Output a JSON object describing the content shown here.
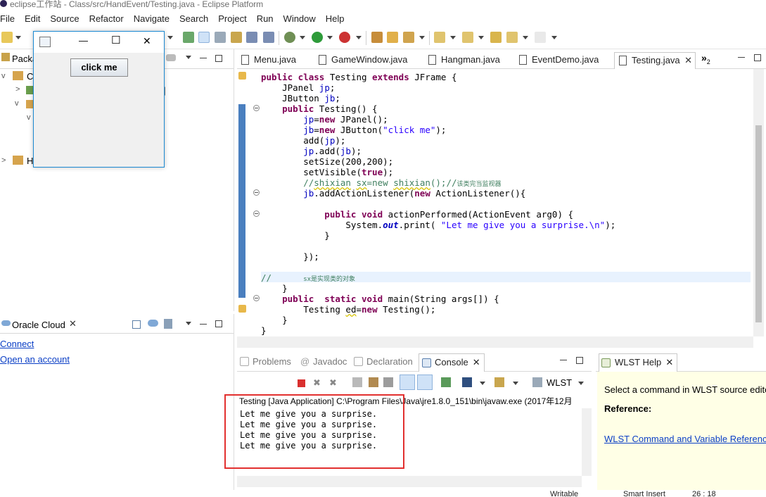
{
  "window": {
    "title": "eclipse工作站 - Class/src/HandEvent/Testing.java - Eclipse Platform"
  },
  "menu": [
    "File",
    "Edit",
    "Source",
    "Refactor",
    "Navigate",
    "Search",
    "Project",
    "Run",
    "Window",
    "Help"
  ],
  "package_explorer": {
    "tab_label": "Packa",
    "rows": [
      {
        "label": "Cl"
      },
      {
        "label": "H"
      }
    ],
    "bracket": "]"
  },
  "editor": {
    "tabs": [
      {
        "label": "Menu.java"
      },
      {
        "label": "GameWindow.java"
      },
      {
        "label": "Hangman.java"
      },
      {
        "label": "EventDemo.java"
      },
      {
        "label": "Testing.java"
      }
    ],
    "overflow_label": "»",
    "overflow_count": "2",
    "code": {
      "l1_kw1": "public class",
      "l1_name": " Testing ",
      "l1_kw2": "extends",
      "l1_rest": " JFrame {",
      "l2_type": "    JPanel ",
      "l2_fld": "jp",
      "l2_end": ";",
      "l3_type": "    JButton ",
      "l3_fld": "jb",
      "l3_end": ";",
      "l4_kw": "    public",
      "l4_rest": " Testing() {",
      "l5_fld": "        jp",
      "l5_eq": "=",
      "l5_kw": "new",
      "l5_rest": " JPanel();",
      "l6_fld": "        jb",
      "l6_eq": "=",
      "l6_kw": "new",
      "l6_mid": " JButton(",
      "l6_str": "\"click me\"",
      "l6_end": ");",
      "l7_a": "        add(",
      "l7_fld": "jp",
      "l7_b": ");",
      "l8_fld": "        jp",
      "l8_a": ".add(",
      "l8_fld2": "jb",
      "l8_b": ");",
      "l9": "        setSize(200,200);",
      "l10_a": "        setVisible(",
      "l10_kw": "true",
      "l10_b": ");",
      "l11_a": "        //",
      "l11_u1": "shixian",
      "l11_b": " ",
      "l11_u2": "sx",
      "l11_c": "=new ",
      "l11_u3": "shixian",
      "l11_d": "();//",
      "l11_z": "该类完当监视器",
      "l12_fld": "        jb",
      "l12_a": ".addActionListener(",
      "l12_kw": "new",
      "l12_b": " ActionListener(){",
      "l14_kw": "            public void",
      "l14_rest": " actionPerformed(ActionEvent arg0) {",
      "l15_a": "                System.",
      "l15_it": "out",
      "l15_b": ".print( ",
      "l15_str": "\"Let me give you a surprise.\\n\"",
      "l15_c": ");",
      "l16": "            }",
      "l18": "        });",
      "l20_a": "//      ",
      "l20_z": "sx是实现类的对象",
      "l21": "    }",
      "l22_kw": "    public  static void",
      "l22_rest": " main(String args[]) {",
      "l23_a": "        Testing ",
      "l23_u": "ed",
      "l23_b": "=",
      "l23_kw": "new",
      "l23_c": " Testing();",
      "l24": "    }",
      "l25": "}"
    }
  },
  "oracle_cloud": {
    "tab_label": "Oracle Cloud",
    "connect_link": "Connect",
    "account_link": "Open an account"
  },
  "console": {
    "tabs": [
      {
        "label": "Problems"
      },
      {
        "label": "Javadoc"
      },
      {
        "label": "Declaration"
      },
      {
        "label": "Console"
      }
    ],
    "wlst_label": "WLST",
    "header": "Testing [Java Application] C:\\Program Files\\Java\\jre1.8.0_151\\bin\\javaw.exe (2017年12月",
    "output": [
      "Let me give you a surprise.",
      "Let me give you a surprise.",
      "Let me give you a surprise.",
      "Let me give you a surprise."
    ]
  },
  "wlst_help": {
    "tab_label": "WLST Help",
    "intro": "Select a command in WLST source editor",
    "reference_label": "Reference:",
    "reference_link": "WLST Command and Variable Reference"
  },
  "floating_window": {
    "button_label": "click me",
    "minimize": "—",
    "maximize": "☐",
    "close": "✕"
  },
  "status": {
    "writable": "Writable",
    "insert_mode": "Smart Insert",
    "position": "26 : 18"
  },
  "colors": {
    "accent": "#1c8ad3",
    "highlight_box": "#e2302f",
    "ruler_blue": "#4a7fbf"
  }
}
